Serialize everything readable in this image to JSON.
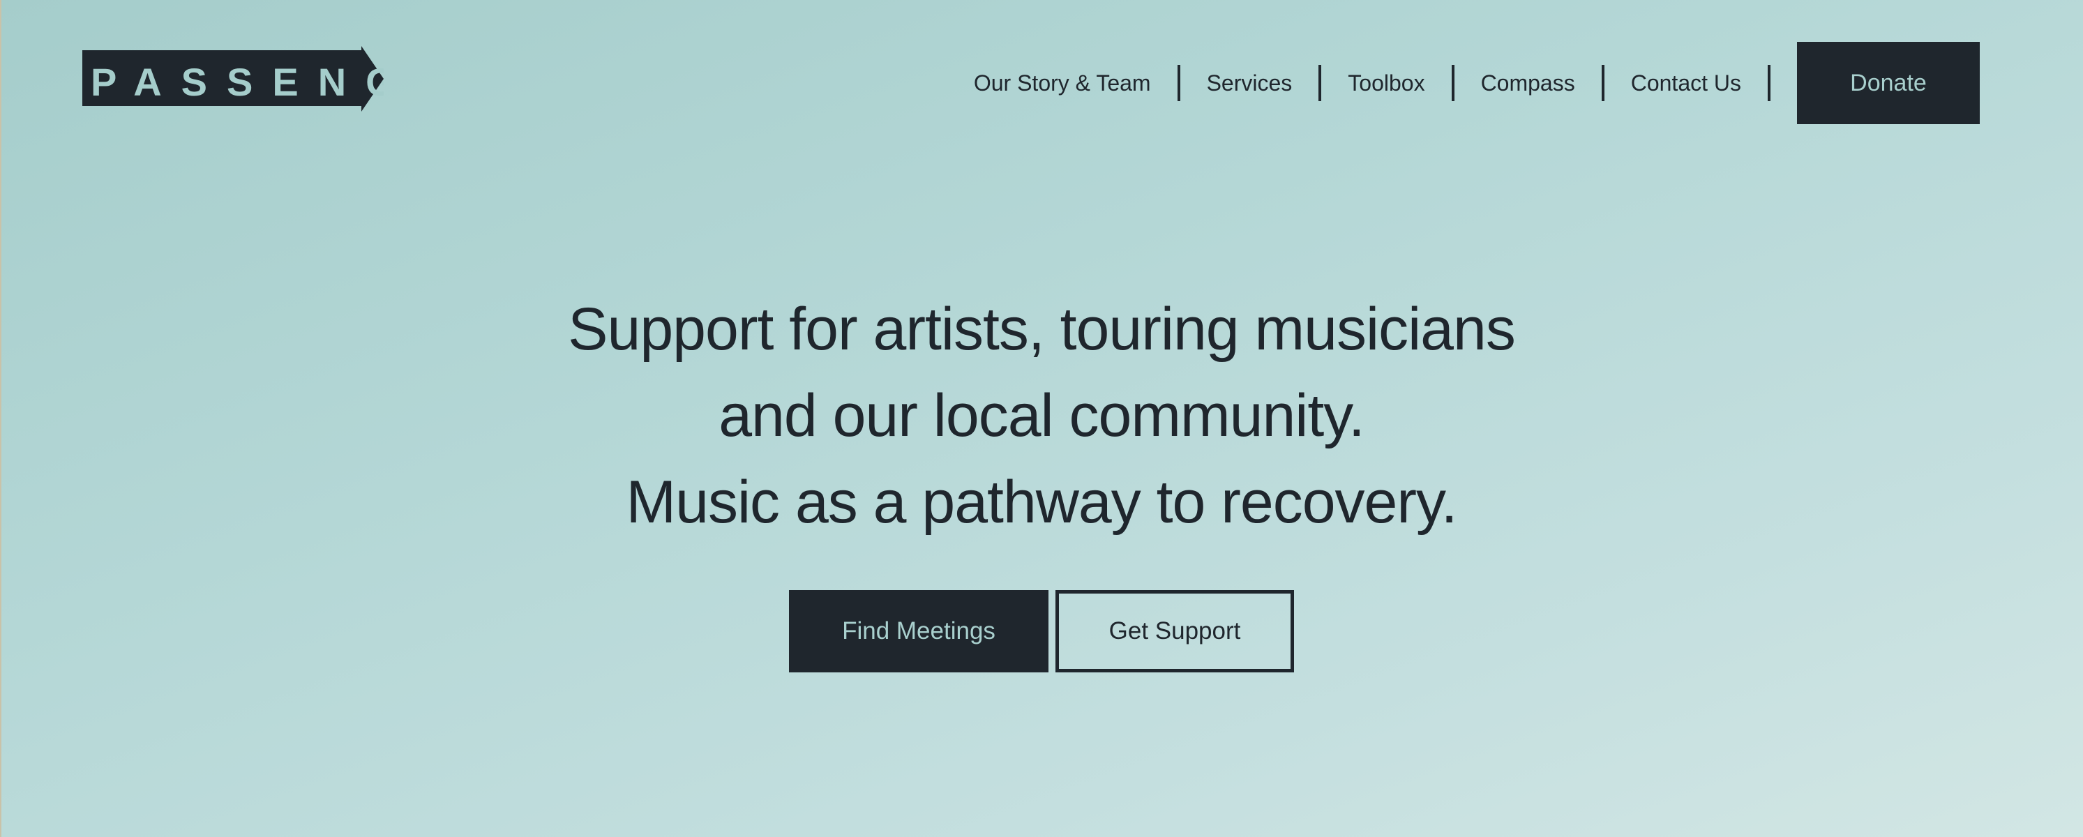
{
  "brand": {
    "logo_text": "PASSENGER",
    "colors": {
      "background_start": "#a5cdcb",
      "background_end": "#d2e6e4",
      "dark": "#1f262d",
      "accent": "#a9d0ce"
    }
  },
  "nav": {
    "items": [
      {
        "label": "Our Story & Team"
      },
      {
        "label": "Services"
      },
      {
        "label": "Toolbox"
      },
      {
        "label": "Compass"
      },
      {
        "label": "Contact Us"
      }
    ],
    "donate_label": "Donate"
  },
  "hero": {
    "lines": [
      "Support for artists, touring musicians",
      "and our local community.",
      "Music as a pathway to recovery."
    ],
    "primary_cta": "Find Meetings",
    "secondary_cta": "Get Support"
  }
}
